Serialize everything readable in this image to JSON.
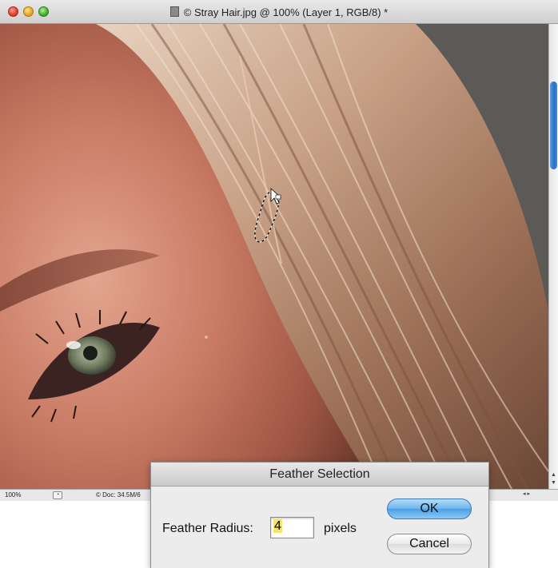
{
  "window": {
    "title": "© Stray Hair.jpg @ 100% (Layer 1, RGB/8) *"
  },
  "statusbar": {
    "zoom": "100%",
    "doc_info": "© Doc: 34.5M/6"
  },
  "dialog": {
    "title": "Feather Selection",
    "feather_radius_label": "Feather Radius:",
    "feather_radius_value": "4",
    "unit": "pixels",
    "ok_label": "OK",
    "cancel_label": "Cancel"
  },
  "colors": {
    "ok_button": "#5aa8ea",
    "input_highlight": "#f6e36b",
    "scroll_thumb": "#2a6fc4"
  }
}
